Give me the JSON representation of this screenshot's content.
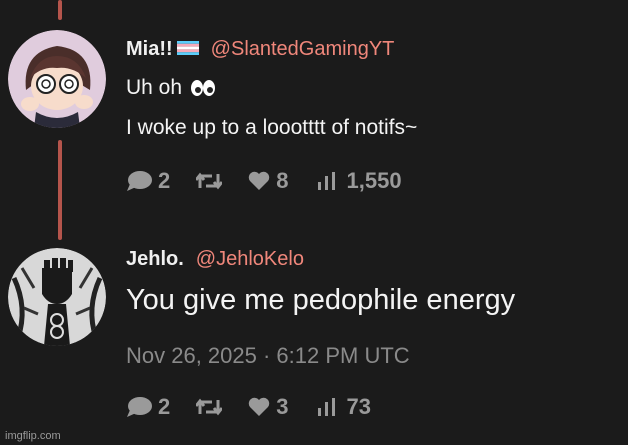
{
  "posts": [
    {
      "author_name": "Mia!!",
      "handle": "@SlantedGamingYT",
      "lines": [
        "Uh oh",
        "I woke up to a loootttt of notifs~"
      ],
      "emoji_icon": "eyes-icon",
      "flag_icon": "transgender-flag-icon",
      "stats": {
        "replies": "2",
        "likes": "8",
        "views": "1,550"
      }
    },
    {
      "author_name": "Jehlo.",
      "handle": "@JehloKelo",
      "lines": [
        "You give me pedophile energy"
      ],
      "timestamp": "Nov 26, 2025 · 6:12 PM UTC",
      "stats": {
        "replies": "2",
        "likes": "3",
        "views": "73"
      }
    }
  ],
  "watermark": "imgflip.com",
  "colors": {
    "background": "#1b1b1b",
    "thread_line": "#b5554c",
    "handle": "#f0877b",
    "meta": "#9a9a9a"
  }
}
